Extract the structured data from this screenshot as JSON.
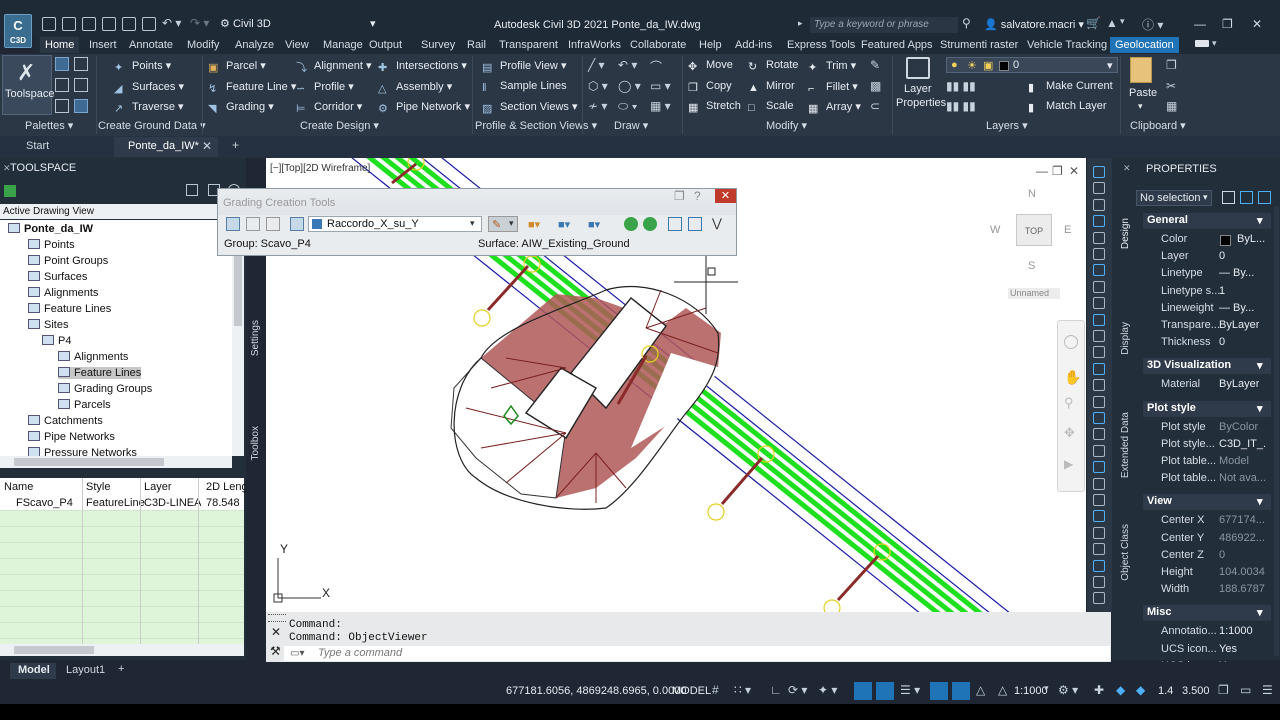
{
  "titlebar": {
    "logo_text": "C",
    "logo_sub": "C3D",
    "workspace": "Civil 3D",
    "title": "Autodesk Civil 3D 2021    Ponte_da_IW.dwg",
    "search_placeholder": "Type a keyword or phrase",
    "user": "salvatore.macri"
  },
  "ribbon_tabs": [
    "Home",
    "Insert",
    "Annotate",
    "Modify",
    "Analyze",
    "View",
    "Manage",
    "Output",
    "Survey",
    "Rail",
    "Transparent",
    "InfraWorks",
    "Collaborate",
    "Help",
    "Add-ins",
    "Express Tools",
    "Featured Apps",
    "Strumenti raster",
    "Vehicle Tracking",
    "Geolocation"
  ],
  "ribbon": {
    "toolspace": "Toolspace",
    "points": "Points",
    "surfaces": "Surfaces",
    "traverse": "Traverse",
    "parcel": "Parcel",
    "feature_line": "Feature Line",
    "grading": "Grading",
    "alignment": "Alignment",
    "profile": "Profile",
    "corridor": "Corridor",
    "intersections": "Intersections",
    "assembly": "Assembly",
    "pipe_network": "Pipe Network",
    "profile_view": "Profile View",
    "sample_lines": "Sample Lines",
    "section_views": "Section Views",
    "move": "Move",
    "copy": "Copy",
    "stretch": "Stretch",
    "rotate": "Rotate",
    "mirror": "Mirror",
    "scale": "Scale",
    "trim": "Trim",
    "fillet": "Fillet",
    "array": "Array",
    "layer_properties_1": "Layer",
    "layer_properties_2": "Properties",
    "layer_value": "0",
    "make_current": "Make Current",
    "match_layer": "Match Layer",
    "paste": "Paste",
    "panels": [
      "Palettes",
      "Create Ground Data",
      "Create Design",
      "Profile & Section Views",
      "Draw",
      "Modify",
      "Layers",
      "Clipboard"
    ]
  },
  "doc_tabs": {
    "start": "Start",
    "active": "Ponte_da_IW*"
  },
  "toolspace": {
    "header": "TOOLSPACE",
    "view": "Active Drawing View",
    "tree": [
      {
        "label": "Ponte_da_IW",
        "bold": true
      },
      {
        "label": "Points"
      },
      {
        "label": "Point Groups"
      },
      {
        "label": "Surfaces"
      },
      {
        "label": "Alignments"
      },
      {
        "label": "Feature Lines"
      },
      {
        "label": "Sites"
      },
      {
        "label": "P4"
      },
      {
        "label": "Alignments"
      },
      {
        "label": "Feature Lines",
        "selected": true
      },
      {
        "label": "Grading Groups"
      },
      {
        "label": "Parcels"
      },
      {
        "label": "Catchments"
      },
      {
        "label": "Pipe Networks"
      },
      {
        "label": "Pressure Networks"
      }
    ],
    "side_tabs": [
      "Settings",
      "Toolbox"
    ],
    "list_columns": [
      "Name",
      "Style",
      "Layer",
      "2D Leng"
    ],
    "list_rows": [
      [
        "FScavo_P4",
        "FeatureLine",
        "C3D-LINEA",
        "78.548"
      ]
    ]
  },
  "viewport": {
    "label": "[−][Top][2D Wireframe]",
    "viewcube": {
      "n": "N",
      "s": "S",
      "e": "E",
      "w": "W",
      "face": "TOP",
      "ucs": "Unnamed"
    },
    "ucs_x": "X",
    "ucs_y": "Y"
  },
  "grading_tools": {
    "title": "Grading Creation Tools",
    "criteria": "Raccordo_X_su_Y",
    "group": "Group: Scavo_P4",
    "surface": "Surface: AIW_Existing_Ground"
  },
  "command": {
    "line1": "Command:",
    "line2": "Command: ObjectViewer",
    "placeholder": "Type a command"
  },
  "properties": {
    "header": "PROPERTIES",
    "selection": "No selection",
    "side_tabs": [
      "Design",
      "Display",
      "Extended Data",
      "Object Class"
    ],
    "sections": [
      {
        "title": "General",
        "rows": [
          {
            "label": "Color",
            "value": "ByL..."
          },
          {
            "label": "Layer",
            "value": "0"
          },
          {
            "label": "Linetype",
            "value": "— By..."
          },
          {
            "label": "Linetype s...",
            "value": "1"
          },
          {
            "label": "Lineweight",
            "value": "— By..."
          },
          {
            "label": "Transpare...",
            "value": "ByLayer"
          },
          {
            "label": "Thickness",
            "value": "0"
          }
        ]
      },
      {
        "title": "3D Visualization",
        "rows": [
          {
            "label": "Material",
            "value": "ByLayer"
          }
        ]
      },
      {
        "title": "Plot style",
        "rows": [
          {
            "label": "Plot style",
            "value": "ByColor",
            "dim": true
          },
          {
            "label": "Plot style...",
            "value": "C3D_IT_..."
          },
          {
            "label": "Plot table...",
            "value": "Model",
            "dim": true
          },
          {
            "label": "Plot table...",
            "value": "Not ava...",
            "dim": true
          }
        ]
      },
      {
        "title": "View",
        "rows": [
          {
            "label": "Center X",
            "value": "677174...",
            "dim": true
          },
          {
            "label": "Center Y",
            "value": "486922...",
            "dim": true
          },
          {
            "label": "Center Z",
            "value": "0",
            "dim": true
          },
          {
            "label": "Height",
            "value": "104.0034",
            "dim": true
          },
          {
            "label": "Width",
            "value": "188.6787",
            "dim": true
          }
        ]
      },
      {
        "title": "Misc",
        "rows": [
          {
            "label": "Annotatio...",
            "value": "1:1000"
          },
          {
            "label": "UCS icon...",
            "value": "Yes"
          },
          {
            "label": "UCS icon...",
            "value": "Yes"
          }
        ]
      }
    ]
  },
  "status": {
    "model_tab": "Model",
    "layout_tab": "Layout1",
    "coords": "677181.6056, 4869248.6965, 0.0000",
    "space": "MODEL",
    "scale": "1:1000",
    "v1": "1.4",
    "v2": "3.500"
  },
  "colors": {
    "accent": "#1f73b7",
    "ribbon": "#2c3746",
    "green": "#00dd00",
    "grading": "#8b2a2a"
  }
}
